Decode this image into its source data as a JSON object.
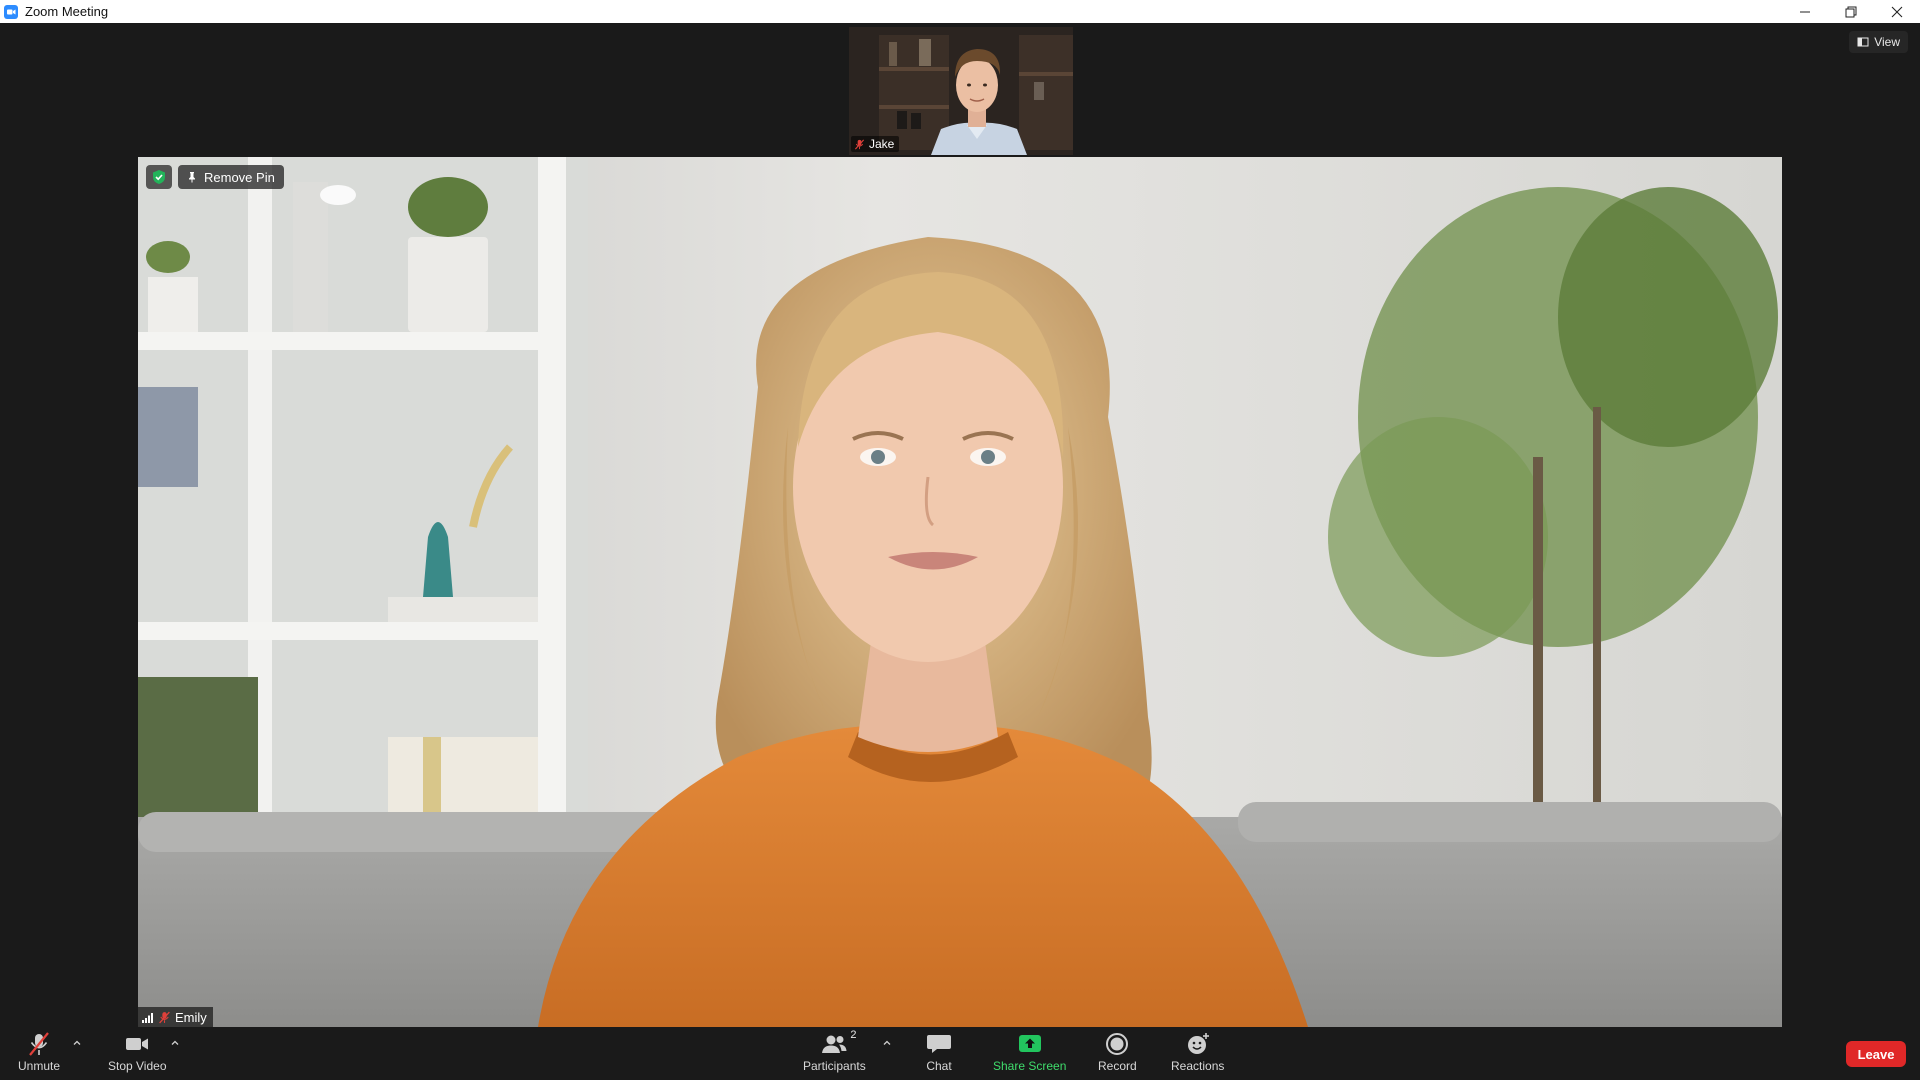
{
  "window": {
    "title": "Zoom Meeting",
    "controls": [
      "minimize-icon",
      "restore-icon",
      "close-icon"
    ]
  },
  "header": {
    "view_label": "View"
  },
  "thumbnail": {
    "participant_name": "Jake",
    "muted": true
  },
  "main_video": {
    "participant_name": "Emily",
    "muted": true,
    "remove_pin_label": "Remove Pin",
    "security_status": "encrypted"
  },
  "toolbar": {
    "unmute_label": "Unmute",
    "stop_video_label": "Stop Video",
    "participants_label": "Participants",
    "participants_count": "2",
    "chat_label": "Chat",
    "share_screen_label": "Share Screen",
    "record_label": "Record",
    "reactions_label": "Reactions",
    "leave_label": "Leave"
  },
  "colors": {
    "background": "#1a1a1a",
    "share_green": "#3fdc6c",
    "leave_red": "#e02828",
    "muted_red": "#e0403a",
    "security_green": "#23b35a"
  }
}
